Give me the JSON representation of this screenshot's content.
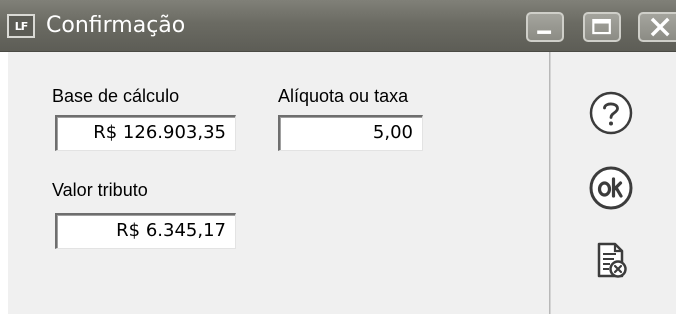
{
  "window": {
    "title": "Confirmação",
    "app_icon_text": "LF",
    "controls": [
      "minimize",
      "maximize",
      "close"
    ]
  },
  "form": {
    "base_calculo": {
      "label": "Base de cálculo",
      "value": "R$ 126.903,35"
    },
    "aliquota": {
      "label": "Alíquota ou taxa",
      "value": "5,00"
    },
    "valor_tributo": {
      "label": "Valor tributo",
      "value": "R$ 6.345,17"
    }
  },
  "sidebar": {
    "icons": [
      "help-icon",
      "ok-icon",
      "cancel-document-icon"
    ]
  },
  "colors": {
    "titlebar": "#6b6b63",
    "window_bg": "#f0f0f0",
    "field_bg": "#ffffff",
    "icon_stroke": "#3c3c3c"
  }
}
